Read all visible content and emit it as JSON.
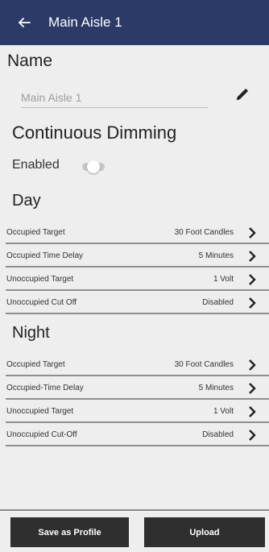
{
  "header": {
    "title": "Main Aisle 1",
    "back_icon": "arrow-left-icon"
  },
  "name_section": {
    "heading": "Name",
    "input_value": "Main Aisle 1",
    "edit_icon": "pencil-icon"
  },
  "continuous_dimming": {
    "heading": "Continuous Dimming",
    "enabled_label": "Enabled",
    "toggle_on": false
  },
  "day": {
    "heading": "Day",
    "rows": [
      {
        "label": "Occupied Target",
        "value": "30 Foot Candles"
      },
      {
        "label": "Occupied Time Delay",
        "value": "5 Minutes"
      },
      {
        "label": "Unoccupied Target",
        "value": "1 Volt"
      },
      {
        "label": "Unoccupied Cut Off",
        "value": "Disabled"
      }
    ]
  },
  "night": {
    "heading": "Night",
    "rows": [
      {
        "label": "Occupied Target",
        "value": "30 Foot Candles"
      },
      {
        "label": "Occupied-Time Delay",
        "value": "5 Minutes"
      },
      {
        "label": "Unoccupied Target",
        "value": "1 Volt"
      },
      {
        "label": "Unoccupied Cut-Off",
        "value": "Disabled"
      }
    ]
  },
  "footer": {
    "save_profile_label": "Save as Profile",
    "upload_label": "Upload"
  },
  "colors": {
    "appbar": "#2b3a67",
    "background": "#eeeeee",
    "button": "#2f2f2f"
  }
}
